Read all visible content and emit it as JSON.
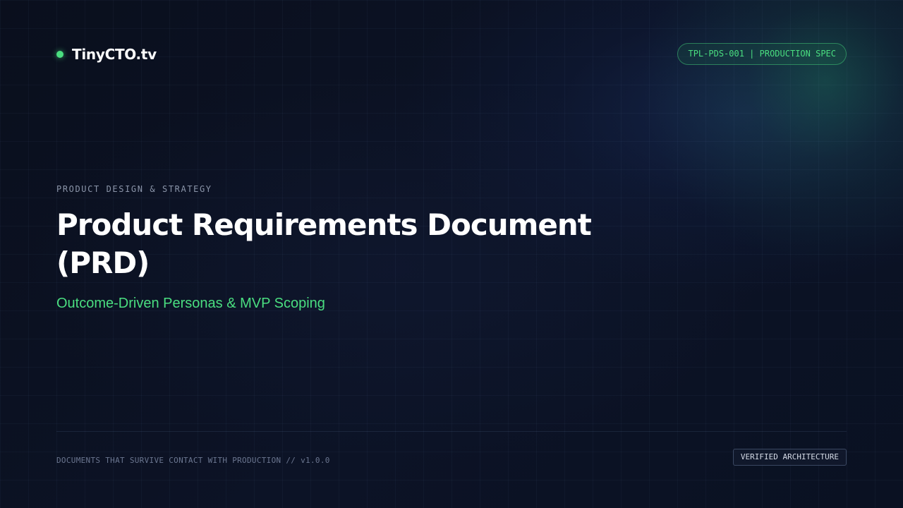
{
  "brand": {
    "name": "TinyCTO.tv",
    "accent_color": "#4ade80"
  },
  "doc_id_badge": "TPL-PDS-001 | PRODUCTION SPEC",
  "hero": {
    "eyebrow": "PRODUCT DESIGN & STRATEGY",
    "title": "Product Requirements Document (PRD)",
    "subtitle": "Outcome-Driven Personas & MVP Scoping"
  },
  "footer": {
    "tagline": "DOCUMENTS THAT SURVIVE CONTACT WITH PRODUCTION // v1.0.0",
    "badge": "VERIFIED ARCHITECTURE"
  },
  "colors": {
    "background": "#0b1020",
    "accent": "#4ade80",
    "title_text": "#ffffff",
    "muted_text": "#8b95a9"
  }
}
